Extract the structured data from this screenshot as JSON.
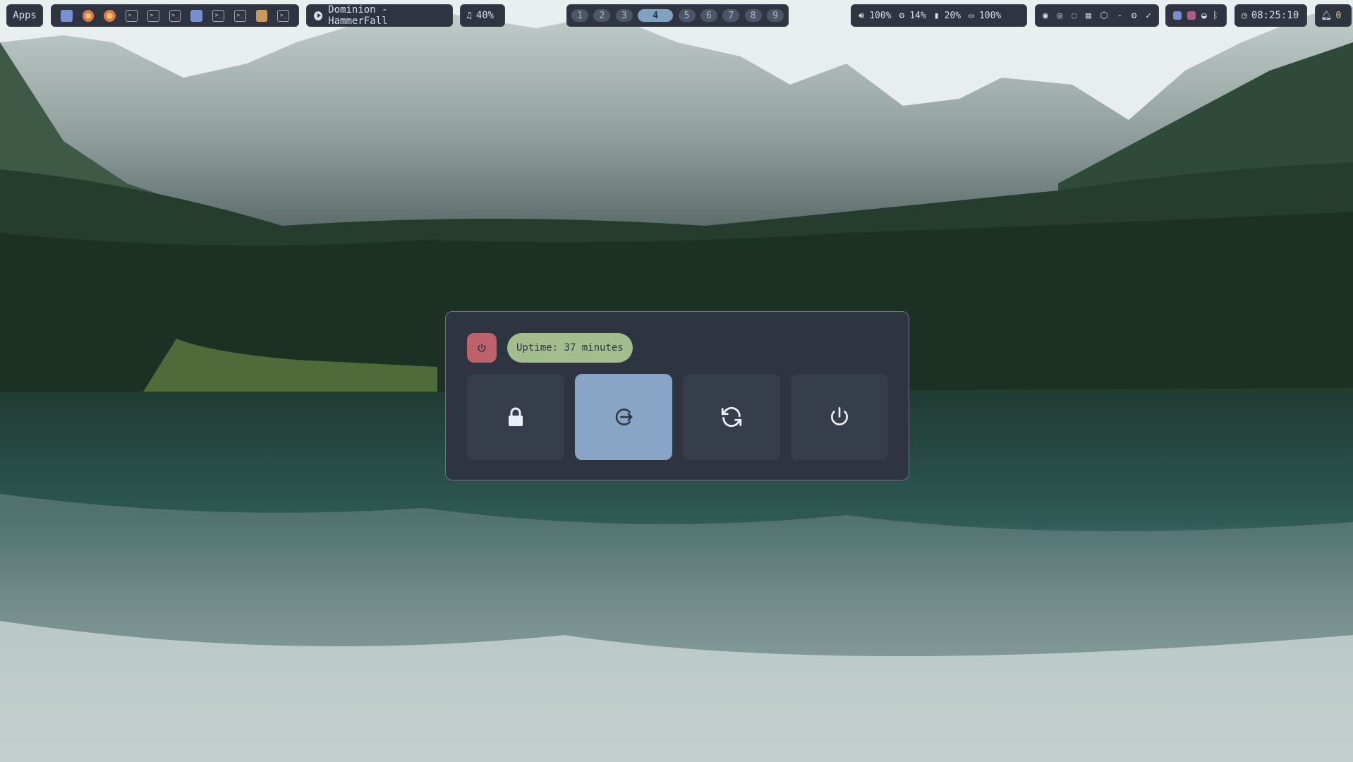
{
  "topbar": {
    "apps_label": "Apps",
    "taskbar": {
      "icons": [
        "teams-icon",
        "browser-icon",
        "browser-icon",
        "terminal-icon",
        "terminal-icon",
        "terminal-icon",
        "teams-icon",
        "terminal-icon",
        "terminal-icon",
        "package-icon",
        "terminal-icon"
      ]
    },
    "media": {
      "now_playing": "Dominion - HammerFall"
    },
    "volume_pill": {
      "value": "40%"
    },
    "workspaces": [
      "1",
      "2",
      "3",
      "4",
      "5",
      "6",
      "7",
      "8",
      "9"
    ],
    "active_workspace": "4",
    "stats": {
      "volume": "100%",
      "cpu": "14%",
      "memory": "20%",
      "battery": "100%"
    },
    "tray_a_icons": [
      "mouse-icon",
      "eye-icon",
      "bell-off-icon",
      "note-icon",
      "cube-icon",
      "dash",
      "gear-icon",
      "check-icon"
    ],
    "tray_b_icons": [
      "teams-icon",
      "app-icon",
      "wifi-icon",
      "bluetooth-icon"
    ],
    "clock": "08:25:10",
    "notifications": "0"
  },
  "power_menu": {
    "uptime": "Uptime: 37 minutes",
    "buttons": [
      {
        "name": "lock-icon",
        "selected": false
      },
      {
        "name": "logout-icon",
        "selected": true
      },
      {
        "name": "reboot-icon",
        "selected": false
      },
      {
        "name": "shutdown-icon",
        "selected": false
      }
    ]
  },
  "colors": {
    "bar_bg": "#2e3440",
    "accent": "#81a1c1",
    "power_red": "#bf616a",
    "uptime_green": "#a3be8c",
    "selected_button": "#88a5c6"
  }
}
